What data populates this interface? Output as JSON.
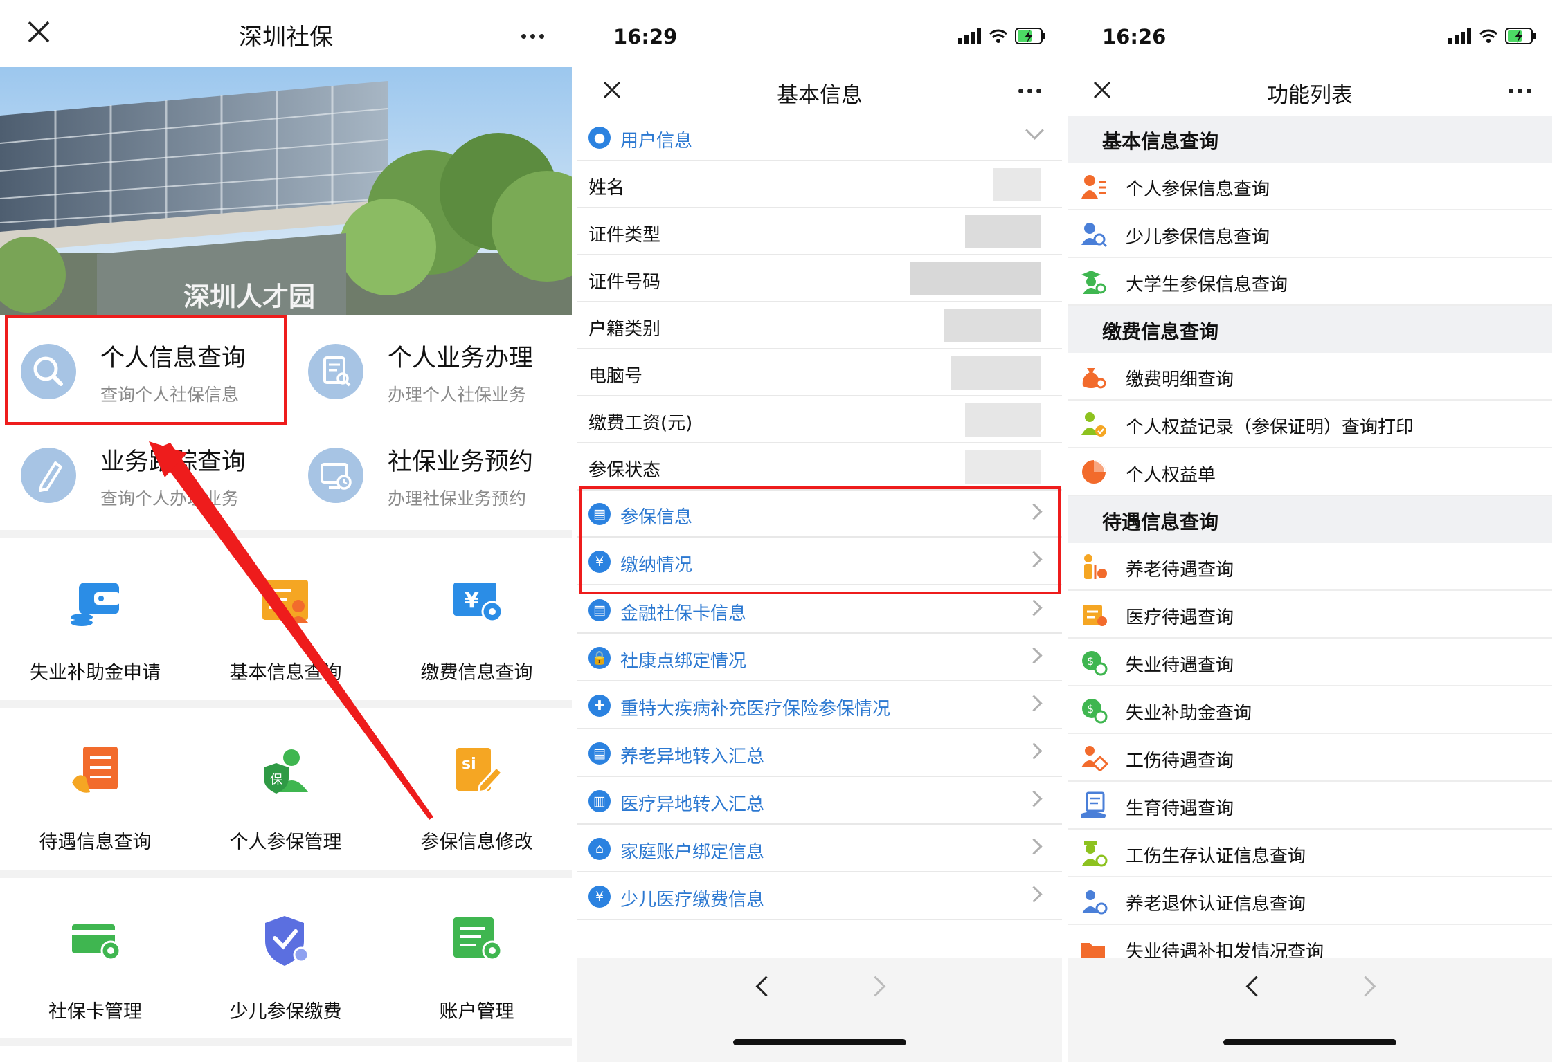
{
  "panel1": {
    "title": "深圳社保",
    "banner_text": "深圳人才园",
    "quick": [
      {
        "title": "个人信息查询",
        "sub": "查询个人社保信息"
      },
      {
        "title": "个人业务办理",
        "sub": "办理个人社保业务"
      },
      {
        "title": "业务跟踪查询",
        "sub": "查询个人办理业务"
      },
      {
        "title": "社保业务预约",
        "sub": "办理社保业务预约"
      }
    ],
    "grid": [
      {
        "label": "失业补助金申请",
        "icon": "wallet-icon",
        "color": "#2b8de6"
      },
      {
        "label": "基本信息查询",
        "icon": "id-card-icon",
        "color": "#f5a623"
      },
      {
        "label": "缴费信息查询",
        "icon": "yuan-gear-icon",
        "color": "#2b8de6"
      },
      {
        "label": "待遇信息查询",
        "icon": "checklist-icon",
        "color": "#f26b2c"
      },
      {
        "label": "个人参保管理",
        "icon": "shield-person-icon",
        "color": "#3fb650"
      },
      {
        "label": "参保信息修改",
        "icon": "si-edit-icon",
        "color": "#f5a623"
      },
      {
        "label": "社保卡管理",
        "icon": "card-gear-icon",
        "color": "#3fb650"
      },
      {
        "label": "少儿参保缴费",
        "icon": "shield-check-icon",
        "color": "#5b6fe0"
      },
      {
        "label": "账户管理",
        "icon": "document-gear-icon",
        "color": "#3fb650"
      }
    ]
  },
  "panel2": {
    "time": "16:29",
    "title": "基本信息",
    "user_section": "用户信息",
    "fields": [
      "姓名",
      "证件类型",
      "证件号码",
      "户籍类别",
      "电脑号",
      "缴费工资(元)",
      "参保状态"
    ],
    "links": [
      {
        "label": "参保信息",
        "glyph": "▤"
      },
      {
        "label": "缴纳情况",
        "glyph": "¥"
      },
      {
        "label": "金融社保卡信息",
        "glyph": "▤"
      },
      {
        "label": "社康点绑定情况",
        "glyph": "🔒"
      },
      {
        "label": "重特大疾病补充医疗保险参保情况",
        "glyph": "✚"
      },
      {
        "label": "养老异地转入汇总",
        "glyph": "▤"
      },
      {
        "label": "医疗异地转入汇总",
        "glyph": "▥"
      },
      {
        "label": "家庭账户绑定信息",
        "glyph": "⌂"
      },
      {
        "label": "少儿医疗缴费信息",
        "glyph": "¥"
      }
    ]
  },
  "panel3": {
    "time": "16:26",
    "title": "功能列表",
    "sections": [
      {
        "title": "基本信息查询",
        "items": [
          {
            "label": "个人参保信息查询",
            "icon": "person-list-icon",
            "color": "#f26b2c"
          },
          {
            "label": "少儿参保信息查询",
            "icon": "child-search-icon",
            "color": "#4a7fd8"
          },
          {
            "label": "大学生参保信息查询",
            "icon": "graduate-search-icon",
            "color": "#3fb650"
          }
        ]
      },
      {
        "title": "缴费信息查询",
        "items": [
          {
            "label": "缴费明细查询",
            "icon": "moneybag-search-icon",
            "color": "#f26b2c"
          },
          {
            "label": "个人权益记录（参保证明）查询打印",
            "icon": "person-check-icon",
            "color": "#8dc21f"
          },
          {
            "label": "个人权益单",
            "icon": "pie-icon",
            "color": "#f26b2c"
          }
        ]
      },
      {
        "title": "待遇信息查询",
        "items": [
          {
            "label": "养老待遇查询",
            "icon": "elder-icon",
            "color": "#f5a623"
          },
          {
            "label": "医疗待遇查询",
            "icon": "calendar-icon",
            "color": "#f5a623"
          },
          {
            "label": "失业待遇查询",
            "icon": "coin-clock-icon",
            "color": "#3fb650"
          },
          {
            "label": "失业补助金查询",
            "icon": "coin-clock-icon",
            "color": "#3fb650"
          },
          {
            "label": "工伤待遇查询",
            "icon": "injury-icon",
            "color": "#f26b2c"
          },
          {
            "label": "生育待遇查询",
            "icon": "hand-doc-icon",
            "color": "#4a7fd8"
          },
          {
            "label": "工伤生存认证信息查询",
            "icon": "person-verify-icon",
            "color": "#8dc21f"
          },
          {
            "label": "养老退休认证信息查询",
            "icon": "person-verify-icon",
            "color": "#4a7fd8"
          },
          {
            "label": "失业待遇补扣发情况查询",
            "icon": "folder-icon",
            "color": "#f26b2c"
          }
        ]
      }
    ]
  }
}
